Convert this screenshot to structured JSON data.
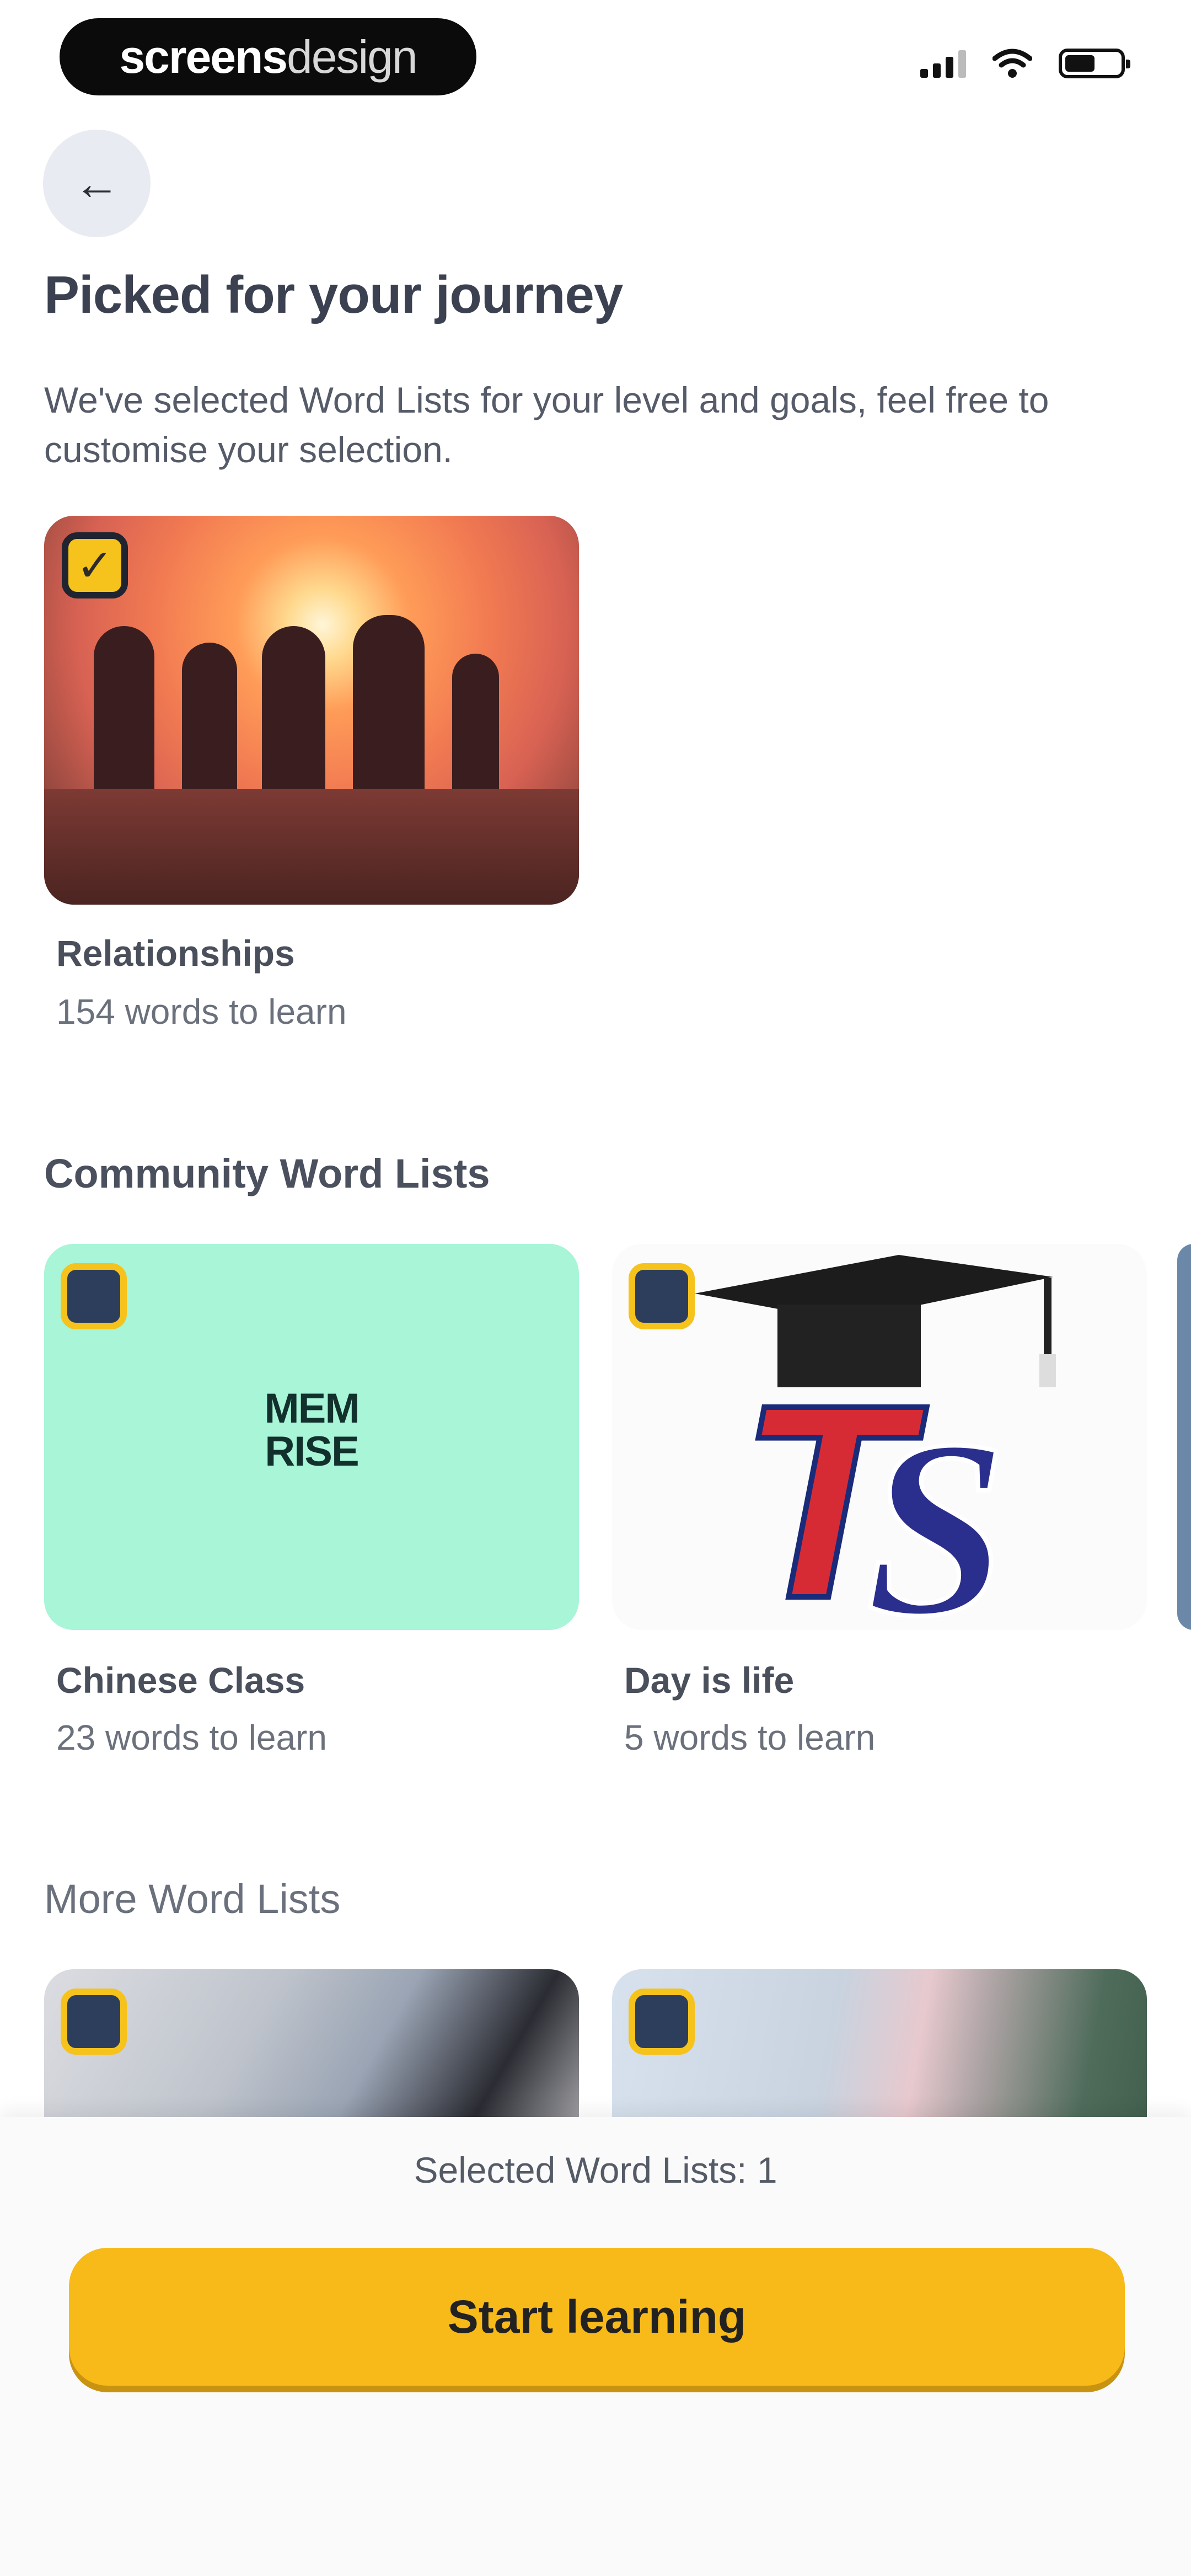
{
  "status_bar": {
    "brand_bold": "screens",
    "brand_light": "design"
  },
  "icons": {
    "back": "arrow-left-icon",
    "check": "checkmark-icon"
  },
  "header": {
    "title": "Picked for your journey",
    "subtitle": "We've selected Word Lists for your level and goals, feel free to customise your selection."
  },
  "picked": [
    {
      "title": "Relationships",
      "count": "154 words to learn",
      "checked": true
    }
  ],
  "community": {
    "heading": "Community Word Lists",
    "items": [
      {
        "title": "Chinese Class",
        "count": "23 words to learn",
        "logo_line1": "MEM",
        "logo_line2": "RISE",
        "checked": false
      },
      {
        "title": "Day is life",
        "count": "5 words to learn",
        "checked": false
      }
    ]
  },
  "more": {
    "heading": "More Word Lists"
  },
  "footer": {
    "selected_label": "Selected Word Lists: 1",
    "start_button": "Start learning"
  },
  "colors": {
    "accent": "#f8ba18",
    "checkbox_empty": "#2c3e5b",
    "memrise_bg": "#a8f5d8"
  }
}
